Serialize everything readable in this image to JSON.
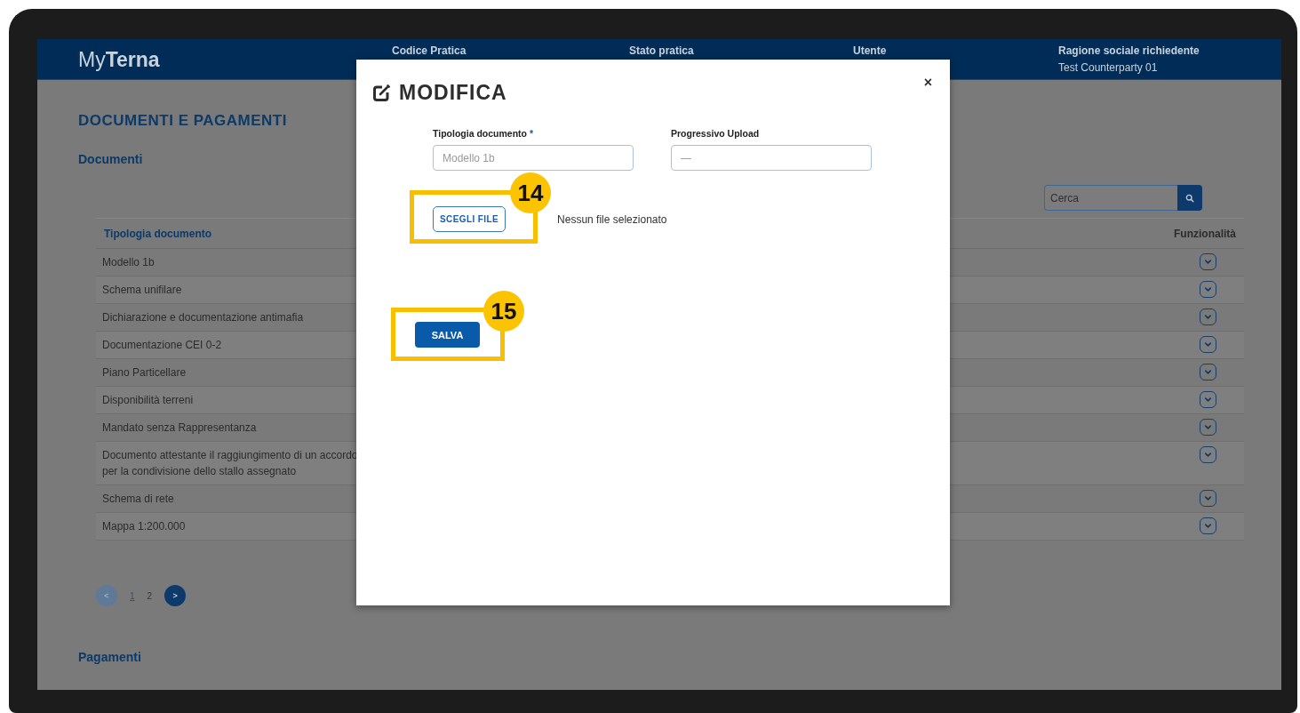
{
  "header": {
    "logo": {
      "prefix": "My",
      "name": "Terna"
    },
    "fields": [
      {
        "label": "Codice Pratica"
      },
      {
        "label": "Stato pratica"
      },
      {
        "label": "Utente"
      },
      {
        "label": "Ragione sociale richiedente",
        "value": "Test Counterparty 01"
      }
    ]
  },
  "page": {
    "title": "DOCUMENTI E PAGAMENTI",
    "section": "Documenti",
    "search": {
      "placeholder": "Cerca"
    },
    "table": {
      "columns": [
        "Tipologia documento",
        "Funzionalità"
      ],
      "rows": [
        {
          "tipologia": "Modello 1b"
        },
        {
          "tipologia": "Schema unifilare"
        },
        {
          "tipologia": "Dichiarazione e documentazione antimafia"
        },
        {
          "tipologia": "Documentazione CEI 0-2"
        },
        {
          "tipologia": "Piano Particellare"
        },
        {
          "tipologia": "Disponibilità terreni"
        },
        {
          "tipologia": "Mandato senza Rappresentanza"
        },
        {
          "tipologia": "Documento attestante il raggiungimento di un accordo per la condivisione dello stallo assegnato"
        },
        {
          "tipologia": "Schema di rete"
        },
        {
          "tipologia": "Mappa 1:200.000"
        }
      ]
    },
    "pagination": {
      "prev": {
        "label": "<",
        "disabled": true
      },
      "pages": [
        {
          "label": "1",
          "selected": true
        },
        {
          "label": "2",
          "selected": false
        }
      ],
      "next": {
        "label": ">",
        "disabled": false
      }
    },
    "section_2": "Pagamenti"
  },
  "modal": {
    "title": "MODIFICA",
    "close": "×",
    "fields": [
      {
        "label": "Tipologia documento",
        "required_mark": "*",
        "placeholder": "Modello 1b"
      },
      {
        "label": "Progressivo Upload",
        "placeholder": "—"
      }
    ],
    "file_button": {
      "label": "SCEGLI FILE",
      "callout": "14"
    },
    "file_status": "Nessun file selezionato",
    "save_button": {
      "label": "SALVA",
      "callout": "15"
    }
  }
}
